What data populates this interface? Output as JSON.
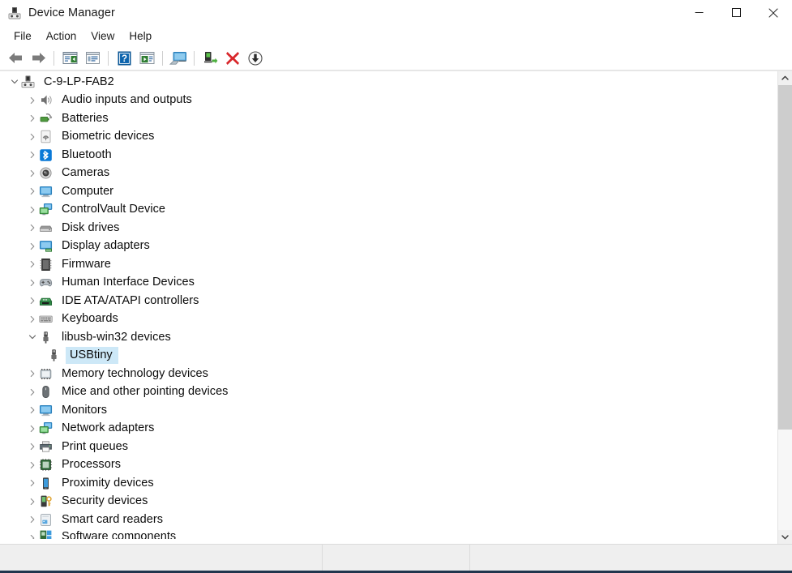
{
  "window": {
    "title": "Device Manager",
    "title_icon": "device-manager-icon",
    "controls": {
      "minimize": "minimize-button",
      "maximize": "maximize-button",
      "close": "close-button"
    }
  },
  "menubar": {
    "items": [
      {
        "label": "File"
      },
      {
        "label": "Action"
      },
      {
        "label": "View"
      },
      {
        "label": "Help"
      }
    ]
  },
  "toolbar": {
    "buttons": [
      {
        "name": "back-button",
        "icon": "left-arrow-icon",
        "enabled": true
      },
      {
        "name": "forward-button",
        "icon": "right-arrow-icon",
        "enabled": true
      },
      {
        "name": "separator-1",
        "icon": "separator",
        "enabled": false
      },
      {
        "name": "show-hide-console-tree-button",
        "icon": "console-tree-icon",
        "enabled": true
      },
      {
        "name": "properties-button",
        "icon": "properties-icon",
        "enabled": true
      },
      {
        "name": "separator-2",
        "icon": "separator",
        "enabled": false
      },
      {
        "name": "help-button",
        "icon": "help-question-icon",
        "enabled": true
      },
      {
        "name": "update-driver-button",
        "icon": "update-driver-icon",
        "enabled": true
      },
      {
        "name": "separator-3",
        "icon": "separator",
        "enabled": false
      },
      {
        "name": "scan-for-hardware-changes-button",
        "icon": "scan-monitor-icon",
        "enabled": true
      },
      {
        "name": "separator-4",
        "icon": "separator",
        "enabled": false
      },
      {
        "name": "enable-device-button",
        "icon": "enable-device-icon",
        "enabled": true
      },
      {
        "name": "uninstall-device-button",
        "icon": "red-x-icon",
        "enabled": true
      },
      {
        "name": "disable-device-button",
        "icon": "down-arrow-circle-icon",
        "enabled": true
      }
    ]
  },
  "tree": {
    "nodes": [
      {
        "label": "C-9-LP-FAB2",
        "level": 0,
        "state": "expanded",
        "icon": "computer-root-icon",
        "selected": false
      },
      {
        "label": "Audio inputs and outputs",
        "level": 1,
        "state": "collapsed",
        "icon": "speaker-icon",
        "selected": false
      },
      {
        "label": "Batteries",
        "level": 1,
        "state": "collapsed",
        "icon": "battery-icon",
        "selected": false
      },
      {
        "label": "Biometric devices",
        "level": 1,
        "state": "collapsed",
        "icon": "fingerprint-icon",
        "selected": false
      },
      {
        "label": "Bluetooth",
        "level": 1,
        "state": "collapsed",
        "icon": "bluetooth-icon",
        "selected": false
      },
      {
        "label": "Cameras",
        "level": 1,
        "state": "collapsed",
        "icon": "camera-icon",
        "selected": false
      },
      {
        "label": "Computer",
        "level": 1,
        "state": "collapsed",
        "icon": "monitor-icon",
        "selected": false
      },
      {
        "label": "ControlVault Device",
        "level": 1,
        "state": "collapsed",
        "icon": "network-monitor-icon",
        "selected": false
      },
      {
        "label": "Disk drives",
        "level": 1,
        "state": "collapsed",
        "icon": "disk-drive-icon",
        "selected": false
      },
      {
        "label": "Display adapters",
        "level": 1,
        "state": "collapsed",
        "icon": "display-adapter-icon",
        "selected": false
      },
      {
        "label": "Firmware",
        "level": 1,
        "state": "collapsed",
        "icon": "firmware-chip-icon",
        "selected": false
      },
      {
        "label": "Human Interface Devices",
        "level": 1,
        "state": "collapsed",
        "icon": "gamepad-icon",
        "selected": false
      },
      {
        "label": "IDE ATA/ATAPI controllers",
        "level": 1,
        "state": "collapsed",
        "icon": "ide-controller-icon",
        "selected": false
      },
      {
        "label": "Keyboards",
        "level": 1,
        "state": "collapsed",
        "icon": "keyboard-icon",
        "selected": false
      },
      {
        "label": "libusb-win32 devices",
        "level": 1,
        "state": "expanded",
        "icon": "usb-icon",
        "selected": false
      },
      {
        "label": "USBtiny",
        "level": 2,
        "state": "leaf",
        "icon": "usb-icon",
        "selected": true
      },
      {
        "label": "Memory technology devices",
        "level": 1,
        "state": "collapsed",
        "icon": "memory-icon",
        "selected": false
      },
      {
        "label": "Mice and other pointing devices",
        "level": 1,
        "state": "collapsed",
        "icon": "mouse-icon",
        "selected": false
      },
      {
        "label": "Monitors",
        "level": 1,
        "state": "collapsed",
        "icon": "monitor-icon",
        "selected": false
      },
      {
        "label": "Network adapters",
        "level": 1,
        "state": "collapsed",
        "icon": "network-monitor-icon",
        "selected": false
      },
      {
        "label": "Print queues",
        "level": 1,
        "state": "collapsed",
        "icon": "printer-icon",
        "selected": false
      },
      {
        "label": "Processors",
        "level": 1,
        "state": "collapsed",
        "icon": "processor-icon",
        "selected": false
      },
      {
        "label": "Proximity devices",
        "level": 1,
        "state": "collapsed",
        "icon": "proximity-icon",
        "selected": false
      },
      {
        "label": "Security devices",
        "level": 1,
        "state": "collapsed",
        "icon": "security-key-icon",
        "selected": false
      },
      {
        "label": "Smart card readers",
        "level": 1,
        "state": "collapsed",
        "icon": "smart-card-reader-icon",
        "selected": false
      },
      {
        "label": "Software components",
        "level": 1,
        "state": "collapsed",
        "icon": "software-component-icon",
        "selected": false
      }
    ]
  },
  "scrollbar": {
    "up_arrow": "scroll-up-icon",
    "down_arrow": "scroll-down-icon"
  },
  "statusbar": {
    "pane1": "",
    "pane2": "",
    "pane3": ""
  },
  "colors": {
    "selection": "#cde8f7",
    "accent_blue": "#0078d7",
    "toolbar_red": "#d13438",
    "toolbar_green": "#3f9e35",
    "window_border": "#21354d"
  }
}
